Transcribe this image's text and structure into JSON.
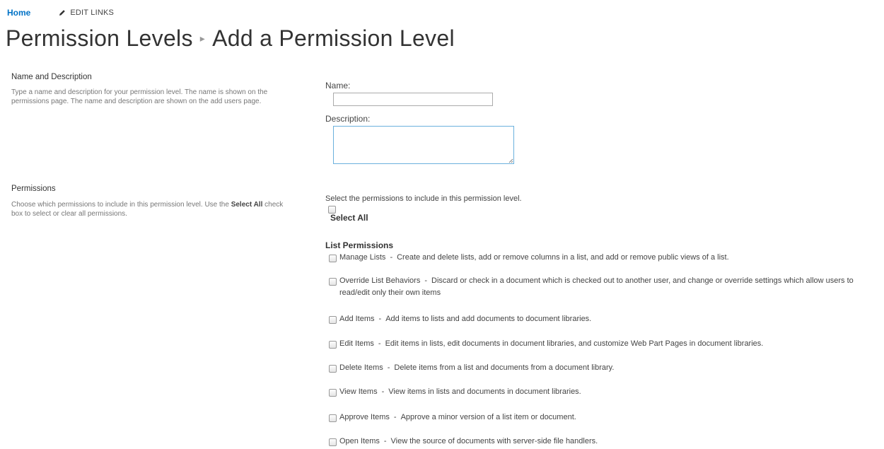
{
  "nav": {
    "home": "Home",
    "edit_links": "EDIT LINKS"
  },
  "title": {
    "parent": "Permission Levels",
    "current": "Add a Permission Level"
  },
  "sections": {
    "name_description": {
      "heading": "Name and Description",
      "description": "Type a name and description for your permission level.  The name is shown on the permissions page.  The name and description are shown on the add users page."
    },
    "permissions": {
      "heading": "Permissions",
      "description_pre": "Choose which permissions to include in this permission level.  Use the ",
      "description_bold": "Select All",
      "description_post": " check box to select or clear all permissions."
    }
  },
  "form": {
    "name_label": "Name:",
    "name_value": "",
    "description_label": "Description:",
    "description_value": ""
  },
  "select_intro": "Select the permissions to include in this permission level.",
  "select_all": "Select All",
  "list_permissions": {
    "title": "List Permissions",
    "separator": "-",
    "items": [
      {
        "name": "Manage Lists",
        "desc": "Create and delete lists, add or remove columns in a list, and add or remove public views of a list."
      },
      {
        "name": "Override List Behaviors",
        "desc": "Discard or check in a document which is checked out to another user, and change or override settings which allow users to read/edit only their own items"
      },
      {
        "name": "Add Items",
        "desc": "Add items to lists and add documents to document libraries."
      },
      {
        "name": "Edit Items",
        "desc": "Edit items in lists, edit documents in document libraries, and customize Web Part Pages in document libraries."
      },
      {
        "name": "Delete Items",
        "desc": "Delete items from a list and documents from a document library."
      },
      {
        "name": "View Items",
        "desc": "View items in lists and documents in document libraries."
      },
      {
        "name": "Approve Items",
        "desc": "Approve a minor version of a list item or document."
      },
      {
        "name": "Open Items",
        "desc": "View the source of documents with server-side file handlers."
      }
    ]
  },
  "icons": {
    "edit": "pencil-icon",
    "breadcrumb_separator": "chevron-right-icon",
    "resize": "resize-grip-icon"
  },
  "colors": {
    "link": "#0072c6",
    "focus_border": "#6bb1dd"
  }
}
